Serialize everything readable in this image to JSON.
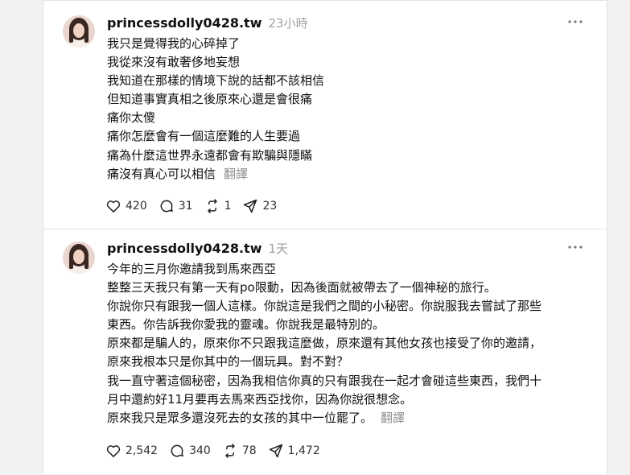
{
  "posts": [
    {
      "username": "princessdolly0428.tw",
      "time": "23小時",
      "lines": [
        "我只是覺得我的心碎掉了",
        "我從來沒有敢奢侈地妄想",
        "我知道在那樣的情境下說的話都不該相信",
        "但知道事實真相之後原來心還是會很痛",
        "痛你太傻",
        "痛你怎麼會有一個這麼難的人生要過",
        "痛為什麼這世界永遠都會有欺騙與隱瞞",
        "痛沒有真心可以相信"
      ],
      "translate_label": "翻譯",
      "likes": "420",
      "comments": "31",
      "reposts": "1",
      "shares": "23"
    },
    {
      "username": "princessdolly0428.tw",
      "time": "1天",
      "lines": [
        "今年的三月你邀請我到馬來西亞",
        "整整三天我只有第一天有po限動，因為後面就被帶去了一個神秘的旅行。",
        "你說你只有跟我一個人這樣。你說這是我們之間的小秘密。你說服我去嘗試了那些",
        "東西。你告訴我你愛我的靈魂。你說我是最特別的。",
        "原來都是騙人的，原來你不只跟我這麼做，原來還有其他女孩也接受了你的邀請，",
        "原來我根本只是你其中的一個玩具。對不對？",
        "我一直守著這個秘密，因為我相信你真的只有跟我在一起才會碰這些東西，我們十",
        "月中還約好11月要再去馬來西亞找你，因為你說很想念。",
        "原來我只是眾多還沒死去的女孩的其中一位罷了。"
      ],
      "translate_label": "翻譯",
      "likes": "2,542",
      "comments": "340",
      "reposts": "78",
      "shares": "1,472"
    }
  ],
  "icons": {
    "like": "heart-icon",
    "comment": "comment-icon",
    "repost": "repost-icon",
    "share": "share-icon",
    "more": "more-icon"
  }
}
